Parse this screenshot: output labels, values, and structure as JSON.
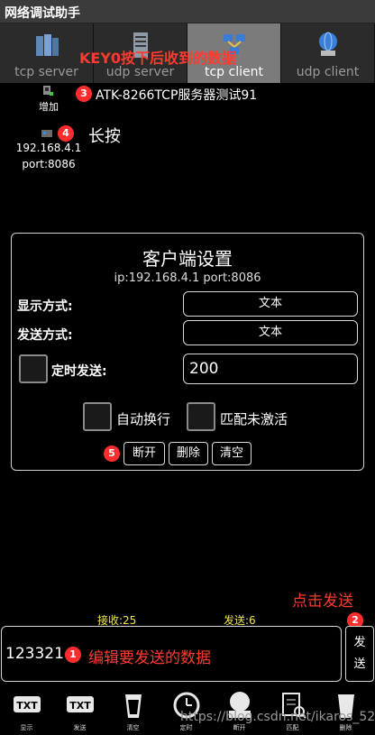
{
  "app": {
    "title": "网络调试助手"
  },
  "tabs": [
    {
      "label": "tcp server",
      "icon": "server-rack-icon",
      "active": false
    },
    {
      "label": "udp server",
      "icon": "server-tower-icon",
      "active": false
    },
    {
      "label": "tcp client",
      "icon": "network-client-icon",
      "active": true
    },
    {
      "label": "udp client",
      "icon": "globe-computer-icon",
      "active": false
    }
  ],
  "annotations": {
    "key0": "KEY0按下后收到的数据",
    "long_press": "长按",
    "click_send": "点击发送",
    "edit_hint": "编辑要发送的数据",
    "badges": [
      "1",
      "2",
      "3",
      "4",
      "5"
    ]
  },
  "left_panel": {
    "add_label": "增加",
    "client_ip": "192.168.4.1",
    "client_port": "port:8086"
  },
  "received_message": "ATK-8266TCP服务器测试91",
  "dialog": {
    "title": "客户端设置",
    "subtitle": "ip:192.168.4.1  port:8086",
    "display_mode_label": "显示方式:",
    "display_mode_value": "文本",
    "send_mode_label": "发送方式:",
    "send_mode_value": "文本",
    "timed_send_label": "定时发送:",
    "timed_send_value": "200",
    "auto_wrap_label": "自动换行",
    "match_inactive_label": "匹配未激活",
    "disconnect_label": "断开",
    "delete_label": "删除",
    "clear_label": "清空"
  },
  "counters": {
    "received": "接收:25",
    "sent": "发送:6"
  },
  "input": {
    "value": "123321"
  },
  "send_button": {
    "label_line1": "发",
    "label_line2": "送"
  },
  "toolbar": [
    {
      "label": "显示",
      "icon": "txt-display-icon"
    },
    {
      "label": "发送",
      "icon": "txt-send-icon"
    },
    {
      "label": "清空",
      "icon": "clear-cup-icon"
    },
    {
      "label": "定时",
      "icon": "clock-icon"
    },
    {
      "label": "断开",
      "icon": "disconnect-icon"
    },
    {
      "label": "匹配",
      "icon": "match-doc-icon"
    },
    {
      "label": "删除",
      "icon": "delete-icon"
    }
  ],
  "watermark": "https://blog.csdn.net/ikaros_521",
  "colors": {
    "annotation_red": "#ff3b30",
    "counter_yellow": "#f2e64a",
    "active_tab": "#7b7b7b"
  }
}
